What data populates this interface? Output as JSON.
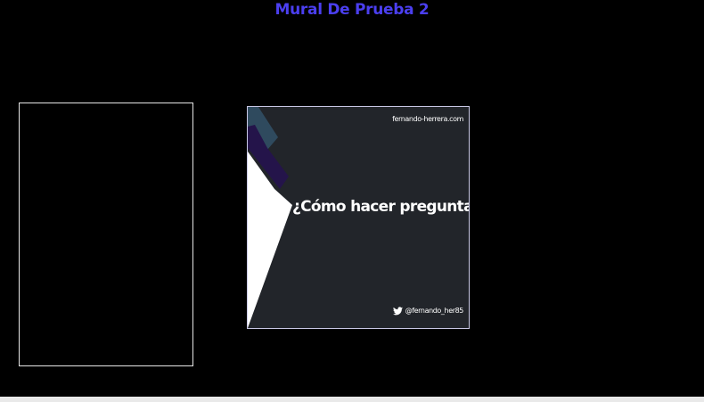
{
  "page": {
    "title": "Mural De Prueba 2"
  },
  "cards": [
    {
      "kind": "empty"
    },
    {
      "kind": "image",
      "site": "fernando-herrera.com",
      "heading": "¿Cómo hacer preguntas?",
      "twitter_handle": "@fernando_her85",
      "icon": "twitter-icon"
    }
  ],
  "colors": {
    "background": "#000000",
    "title": "#4b3ff0",
    "card_bg": "#22252a",
    "accent_dark_blue": "#2f4a5e",
    "accent_purple": "#24144a",
    "accent_white": "#ffffff"
  }
}
